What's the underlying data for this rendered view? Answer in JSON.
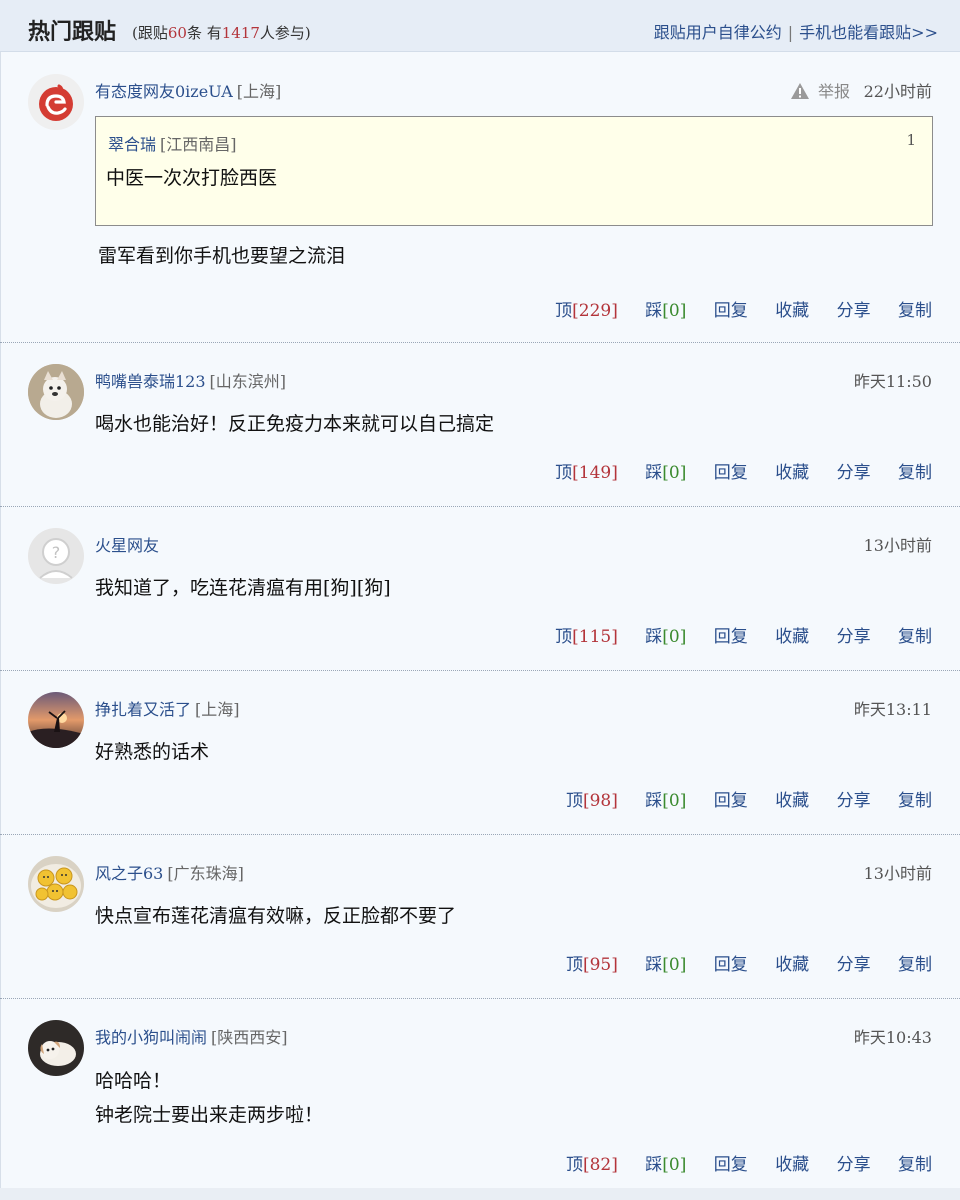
{
  "header": {
    "title": "热门跟贴",
    "stats_prefix": "(跟贴",
    "comment_count": "60",
    "stats_mid": "条 有",
    "participant_count": "1417",
    "stats_suffix": "人参与)",
    "link_convention": "跟贴用户自律公约",
    "link_separator": "|",
    "link_mobile": "手机也能看跟贴>>"
  },
  "labels": {
    "up": "顶",
    "down": "踩",
    "reply": "回复",
    "favorite": "收藏",
    "share": "分享",
    "copy": "复制",
    "report": "举报"
  },
  "comments": [
    {
      "user": "有态度网友0izeUA",
      "location": "[上海]",
      "time": "22小时前",
      "avatar_icon": "netease-logo-icon",
      "quote": {
        "user": "翠合瑞",
        "location": "[江西南昌]",
        "floor": "1",
        "text": "中医一次次打脸西医"
      },
      "text": "雷军看到你手机也要望之流泪",
      "up": "[229]",
      "down": "[0]"
    },
    {
      "user": "鸭嘴兽泰瑞123",
      "location": "[山东滨州]",
      "time": "昨天11:50",
      "avatar_icon": "dog-photo-avatar",
      "text": "喝水也能治好！反正免疫力本来就可以自己搞定",
      "up": "[149]",
      "down": "[0]"
    },
    {
      "user": "火星网友",
      "location": "",
      "time": "13小时前",
      "avatar_icon": "default-user-icon",
      "text": "我知道了，吃连花清瘟有用[狗][狗]",
      "up": "[115]",
      "down": "[0]"
    },
    {
      "user": "挣扎着又活了",
      "location": "[上海]",
      "time": "昨天13:11",
      "avatar_icon": "sunset-photo-avatar",
      "text": "好熟悉的话术",
      "up": "[98]",
      "down": "[0]"
    },
    {
      "user": "风之子63",
      "location": "[广东珠海]",
      "time": "13小时前",
      "avatar_icon": "cookies-photo-avatar",
      "text": "快点宣布莲花清瘟有效嘛，反正脸都不要了",
      "up": "[95]",
      "down": "[0]"
    },
    {
      "user": "我的小狗叫闹闹",
      "location": "[陕西西安]",
      "time": "昨天10:43",
      "avatar_icon": "puppy-photo-avatar",
      "text_line1": "哈哈哈！",
      "text_line2": "钟老院士要出来走两步啦！",
      "up": "[82]",
      "down": "[0]"
    }
  ],
  "colors": {
    "link_blue": "#2b4f8c",
    "count_red": "#b3343a",
    "count_green": "#3a8a2e",
    "header_bg": "#e6edf6",
    "quote_bg": "#ffffea"
  }
}
